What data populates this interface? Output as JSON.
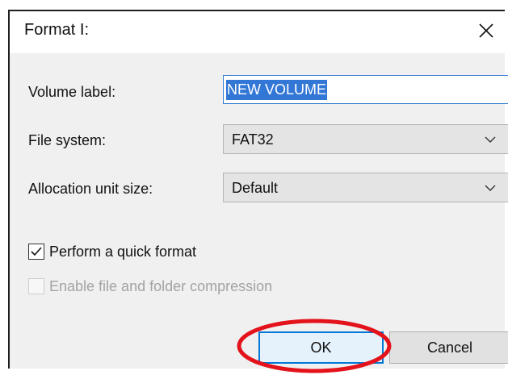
{
  "window": {
    "title": "Format I:",
    "close_glyph": "✕"
  },
  "form": {
    "volume_label": {
      "label": "Volume label:",
      "value": "NEW VOLUME"
    },
    "file_system": {
      "label": "File system:",
      "selected": "FAT32"
    },
    "allocation_unit_size": {
      "label": "Allocation unit size:",
      "selected": "Default"
    }
  },
  "options": {
    "quick_format": {
      "label": "Perform a quick format",
      "checked": true,
      "enabled": true
    },
    "compression": {
      "label": "Enable file and folder compression",
      "checked": false,
      "enabled": false
    }
  },
  "buttons": {
    "ok_label": "OK",
    "cancel_label": "Cancel"
  },
  "colors": {
    "selection_blue": "#3377d6",
    "focus_blue": "#0078d7",
    "annotation_red": "#e3121b",
    "dialog_body": "#f0f0f0"
  },
  "icons": {
    "close": "close-icon",
    "dropdown": "chevron-down-icon",
    "checkmark": "checkmark-icon"
  }
}
